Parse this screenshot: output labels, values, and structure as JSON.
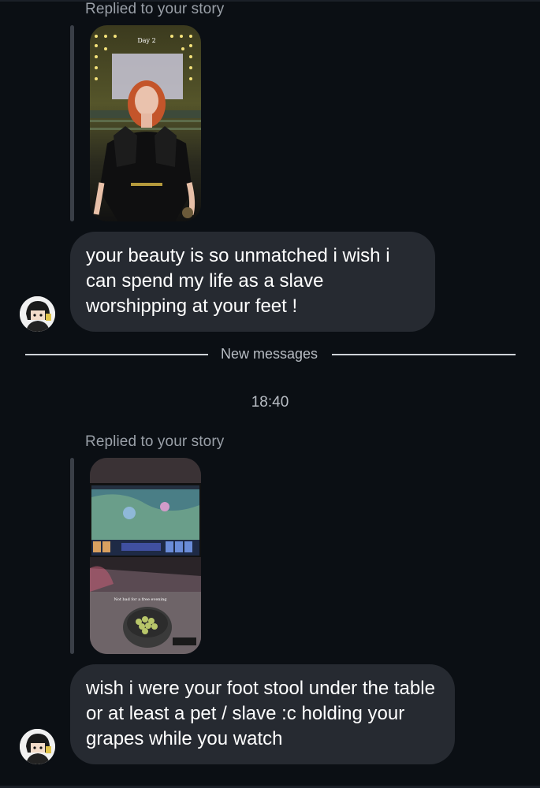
{
  "thread": {
    "new_messages_label": "New messages",
    "timestamp": "18:40"
  },
  "messages": [
    {
      "reply_label": "Replied to your story",
      "story_caption": "Day 2",
      "text": "your beauty is so unmatched i wish i can spend my life as a slave worshipping at your feet !"
    },
    {
      "reply_label": "Replied to your story",
      "story_caption": "Not bad for a free evening",
      "text": "wish i were your foot stool under the table or at least a pet / slave :c holding your grapes while you watch"
    }
  ],
  "colors": {
    "background": "#0b0f14",
    "bubble": "#262a31",
    "secondary_text": "#9aa0a8"
  }
}
